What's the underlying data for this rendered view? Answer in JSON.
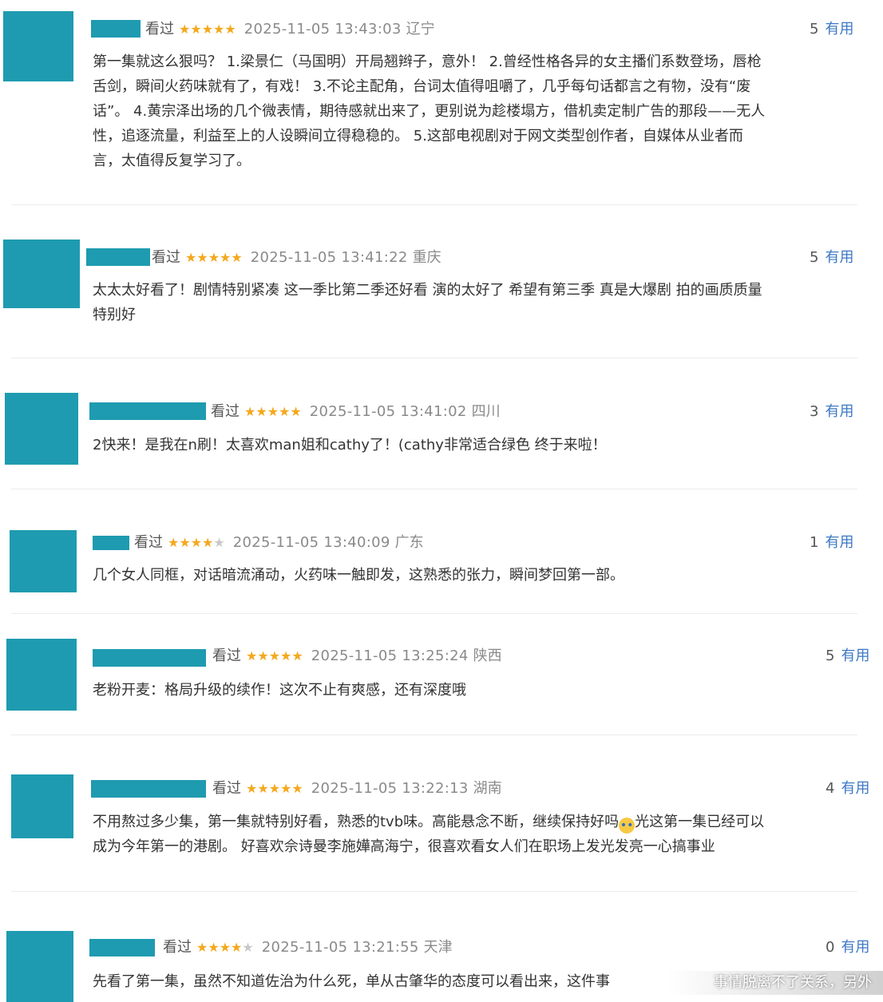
{
  "reviews": [
    {
      "watched_label": "看过",
      "stars": "★★★★★",
      "stars_off": "",
      "date": "2025-11-05 13:43:03",
      "location": "辽宁",
      "useful_count": "5",
      "useful_label": "有用",
      "lines": [
        "第一集就这么狠吗？ 1.梁景仁（马国明）开局翘辫子，意外！ 2.曾经性格各异的女主播们系数登场，唇枪",
        "舌剑，瞬间火药味就有了，有戏！ 3.不论主配角，台词太值得咀嚼了，几乎每句话都言之有物，没有“废",
        "话”。 4.黄宗泽出场的几个微表情，期待感就出来了，更别说为趁楼塌方，借机卖定制广告的那段——无人",
        "性，追逐流量，利益至上的人设瞬间立得稳稳的。 5.这部电视剧对于网文类型创作者，自媒体从业者而",
        "言，太值得反复学习了。"
      ]
    },
    {
      "watched_label": "看过",
      "stars": "★★★★★",
      "stars_off": "",
      "date": "2025-11-05 13:41:22",
      "location": "重庆",
      "useful_count": "5",
      "useful_label": "有用",
      "lines": [
        "太太太好看了！剧情特别紧凑 这一季比第二季还好看 演的太好了 希望有第三季 真是大爆剧 拍的画质质量",
        "特别好"
      ]
    },
    {
      "watched_label": "看过",
      "stars": "★★★★★",
      "stars_off": "",
      "date": "2025-11-05 13:41:02",
      "location": "四川",
      "useful_count": "3",
      "useful_label": "有用",
      "lines": [
        "2快来！是我在n刷！太喜欢man姐和cathy了！(cathy非常适合绿色 终于来啦！"
      ]
    },
    {
      "watched_label": "看过",
      "stars": "★★★★",
      "stars_off": "★",
      "date": "2025-11-05 13:40:09",
      "location": "广东",
      "useful_count": "1",
      "useful_label": "有用",
      "lines": [
        "几个女人同框，对话暗流涌动，火药味一触即发，这熟悉的张力，瞬间梦回第一部。"
      ]
    },
    {
      "watched_label": "看过",
      "stars": "★★★★★",
      "stars_off": "",
      "date": "2025-11-05 13:25:24",
      "location": "陕西",
      "useful_count": "5",
      "useful_label": "有用",
      "lines": [
        "老粉开麦：格局升级的续作！这次不止有爽感，还有深度哦"
      ]
    },
    {
      "watched_label": "看过",
      "stars": "★★★★★",
      "stars_off": "",
      "date": "2025-11-05 13:22:13",
      "location": "湖南",
      "useful_count": "4",
      "useful_label": "有用",
      "line1_a": "不用熬过多少集，第一集就特别好看，熟悉的tvb味。高能悬念不断，继续保持好吗",
      "line1_b": "光这第一集已经可以",
      "line2": "成为今年第一的港剧。 好喜欢佘诗曼李施嬅高海宁，很喜欢看女人们在职场上发光发亮一心搞事业"
    },
    {
      "watched_label": "看过",
      "stars": "★★★★",
      "stars_off": "★",
      "date": "2025-11-05 13:21:55",
      "location": "天津",
      "useful_count": "0",
      "useful_label": "有用",
      "lines": [
        "先看了第一集，虽然不知道佐治为什么死，单从古肇华的态度可以看出来，这件事"
      ]
    }
  ],
  "watermark_text": "事情脱离不了关系，另外"
}
